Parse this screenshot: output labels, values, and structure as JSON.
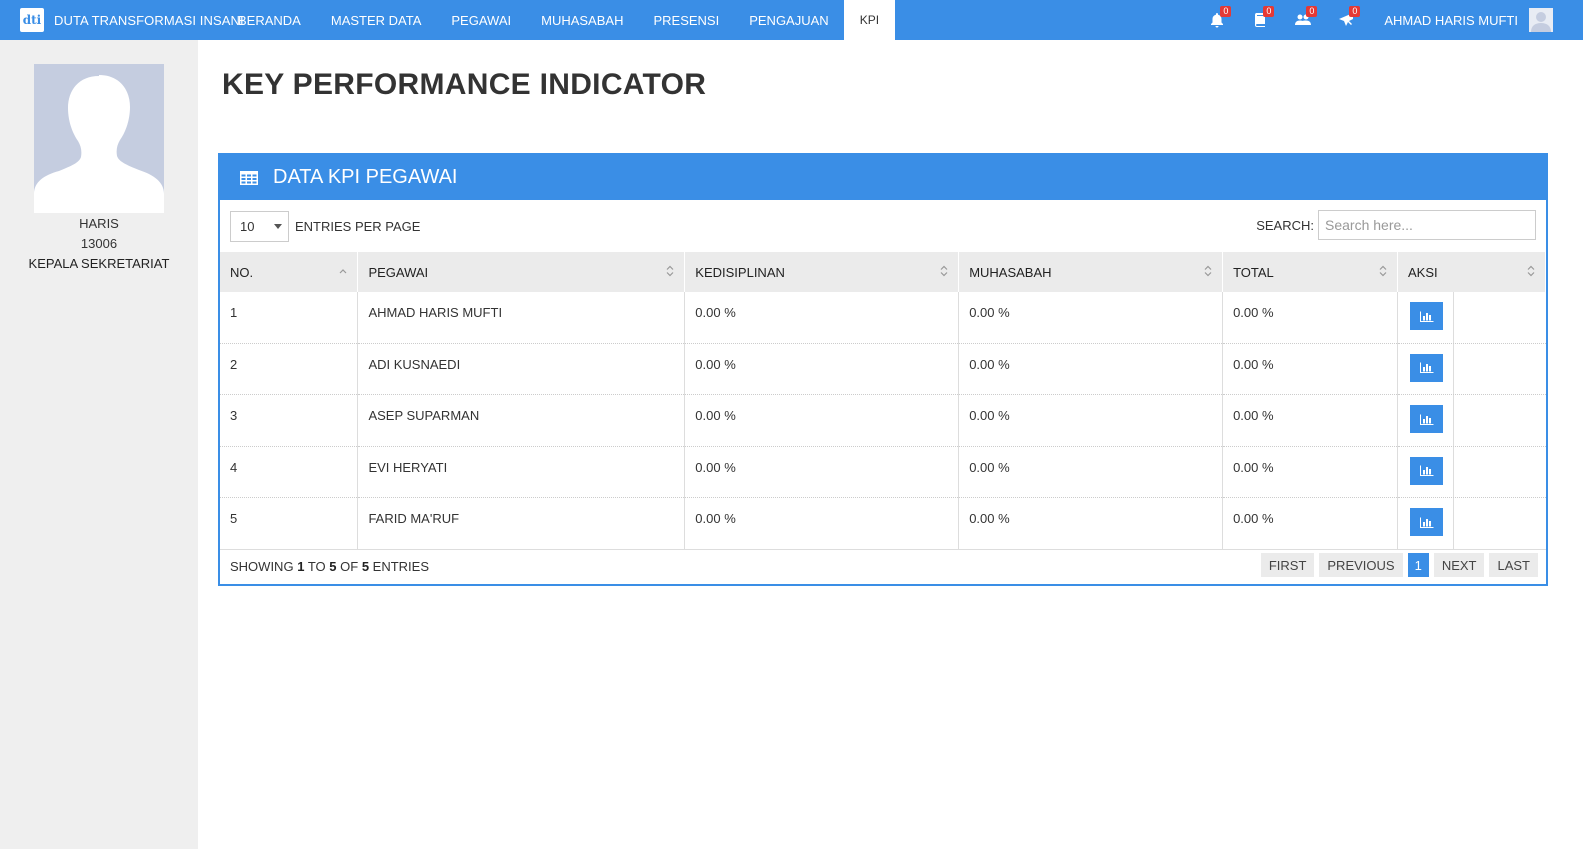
{
  "brand": {
    "name": "DUTA TRANSFORMASI INSANI",
    "logo_text": "dti",
    "logo_icon": "brand-logo-icon"
  },
  "nav": {
    "items": [
      {
        "label": "BERANDA",
        "active": false
      },
      {
        "label": "MASTER DATA",
        "active": false
      },
      {
        "label": "PEGAWAI",
        "active": false
      },
      {
        "label": "MUHASABAH",
        "active": false
      },
      {
        "label": "PRESENSI",
        "active": false
      },
      {
        "label": "PENGAJUAN",
        "active": false
      },
      {
        "label": "KPI",
        "active": true
      }
    ],
    "notifications": [
      {
        "icon": "bell-icon",
        "count": "0"
      },
      {
        "icon": "book-icon",
        "count": "0"
      },
      {
        "icon": "users-icon",
        "count": "0"
      },
      {
        "icon": "plane-icon",
        "count": "0"
      }
    ],
    "user_name": "AHMAD HARIS MUFTI"
  },
  "sidebar": {
    "name": "HARIS",
    "employee_id": "13006",
    "role": "KEPALA SEKRETARIAT"
  },
  "page": {
    "title": "KEY PERFORMANCE INDICATOR"
  },
  "panel": {
    "title": "DATA KPI PEGAWAI",
    "icon": "table-icon",
    "entries_value": "10",
    "entries_label": "ENTRIES PER PAGE",
    "search_label": "SEARCH:",
    "search_placeholder": "Search here...",
    "columns": [
      "NO.",
      "PEGAWAI",
      "KEDISIPLINAN",
      "MUHASABAH",
      "TOTAL",
      "AKSI"
    ],
    "rows": [
      {
        "no": "1",
        "pegawai": "AHMAD HARIS MUFTI",
        "kedisiplinan": "0.00 %",
        "muhasabah": "0.00 %",
        "total": "0.00 %"
      },
      {
        "no": "2",
        "pegawai": "ADI KUSNAEDI",
        "kedisiplinan": "0.00 %",
        "muhasabah": "0.00 %",
        "total": "0.00 %"
      },
      {
        "no": "3",
        "pegawai": "ASEP SUPARMAN",
        "kedisiplinan": "0.00 %",
        "muhasabah": "0.00 %",
        "total": "0.00 %"
      },
      {
        "no": "4",
        "pegawai": "EVI HERYATI",
        "kedisiplinan": "0.00 %",
        "muhasabah": "0.00 %",
        "total": "0.00 %"
      },
      {
        "no": "5",
        "pegawai": "FARID MA'RUF",
        "kedisiplinan": "0.00 %",
        "muhasabah": "0.00 %",
        "total": "0.00 %"
      }
    ],
    "footer": {
      "showing": "SHOWING",
      "from": "1",
      "to_word": "TO",
      "to": "5",
      "of_word": "OF",
      "total": "5",
      "entries_word": "ENTRIES"
    },
    "pager": {
      "first": "FIRST",
      "previous": "PREVIOUS",
      "current": "1",
      "next": "NEXT",
      "last": "LAST"
    }
  },
  "colors": {
    "primary": "#3a8ee6",
    "badge": "#e53935",
    "sidebar_bg": "#efefef"
  }
}
